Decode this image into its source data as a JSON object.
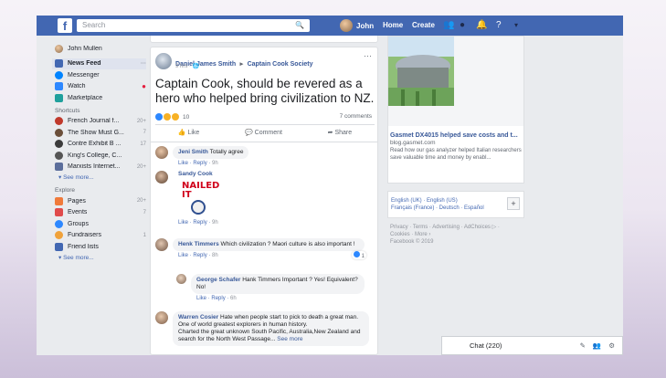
{
  "topbar": {
    "logo": "f",
    "search_placeholder": "Search",
    "search_icon": "search-icon",
    "profile_name": "John",
    "home": "Home",
    "create": "Create",
    "brand_color": "#4267b2"
  },
  "sidebar": {
    "profile": "John Mullen",
    "main_items": [
      {
        "label": "News Feed",
        "icon": "news-feed-icon",
        "color": "#4267b2",
        "extra": "···"
      },
      {
        "label": "Messenger",
        "icon": "messenger-icon",
        "color": "#0084ff"
      },
      {
        "label": "Watch",
        "icon": "watch-icon",
        "color": "#2d88ff"
      },
      {
        "label": "Marketplace",
        "icon": "marketplace-icon",
        "color": "#1fa09c"
      }
    ],
    "shortcuts_heading": "Shortcuts",
    "shortcuts": [
      {
        "label": "French Journal f...",
        "count": "20+",
        "color": "#c0392b"
      },
      {
        "label": "The Show Must G...",
        "count": "7",
        "color": "#6b4f3a"
      },
      {
        "label": "Contre Exhibit B ...",
        "count": "17",
        "color": "#3b3b3b"
      },
      {
        "label": "King's College, C...",
        "count": "",
        "color": "#555"
      },
      {
        "label": "Marxists Internet...",
        "count": "20+",
        "color": "#5b6e9b"
      }
    ],
    "shortcuts_see_more": "See more...",
    "explore_heading": "Explore",
    "explore": [
      {
        "label": "Pages",
        "count": "20+",
        "color": "#f07a3a"
      },
      {
        "label": "Events",
        "count": "7",
        "color": "#e04b4b"
      },
      {
        "label": "Groups",
        "count": "",
        "color": "#2d88ff"
      },
      {
        "label": "Fundraisers",
        "count": "1",
        "color": "#f0a23a"
      },
      {
        "label": "Friend lists",
        "count": "",
        "color": "#4267b2"
      }
    ],
    "explore_see_more": "See more..."
  },
  "post": {
    "author": "Daniel James Smith",
    "arrow": "▸",
    "page": "Captain Cook Society",
    "time": "9 hrs · ",
    "globe": "globe-icon",
    "text": "Captain Cook, should be revered as a hero who helped bring civilization to NZ.",
    "reaction_count": "10",
    "comments_count": "7 comments",
    "like": "Like",
    "comment": "Comment",
    "share": "Share"
  },
  "comments": [
    {
      "name": "Jeni Smith",
      "text": "Totally agree",
      "like": "Like",
      "reply": "Reply",
      "time": "9h"
    },
    {
      "name": "Sandy Cook",
      "sticker_text": "NAILED IT",
      "like": "Like",
      "reply": "Reply",
      "time": "9h"
    },
    {
      "name": "Henk Timmers",
      "text": "Which civilization ? Maori culture is also important !",
      "like": "Like",
      "reply": "Reply",
      "time": "8h",
      "reactions": "1"
    },
    {
      "name": "George Schafer",
      "text": "Hank Timmers Important ? Yes! Equivalent? No!",
      "like": "Like",
      "reply": "Reply",
      "time": "6h"
    },
    {
      "name": "Warren Cosier",
      "text": "Hate when people start to pick to death a great man.",
      "text2": "One of world greatest explorers in human history.",
      "text3": "Charted the great unknown South Pacific, Australia,New Zealand and search for the North West Passage...",
      "see_more": "See more"
    }
  ],
  "ad": {
    "title": "Gasmet DX4015 helped save costs and t...",
    "domain": "blog.gasmet.com",
    "desc": "Read how our gas analyzer helped Italian researchers save valuable time and money by enabl..."
  },
  "languages": {
    "line1": "English (UK) · English (US)",
    "line2": "Français (France) · Deutsch · Español",
    "add": "+"
  },
  "footer": {
    "line1": "Privacy · Terms · Advertising · AdChoices ▷ ·",
    "line2": "Cookies · More ›",
    "line3": "Facebook © 2019"
  },
  "chat": {
    "label": "Chat (220)"
  }
}
